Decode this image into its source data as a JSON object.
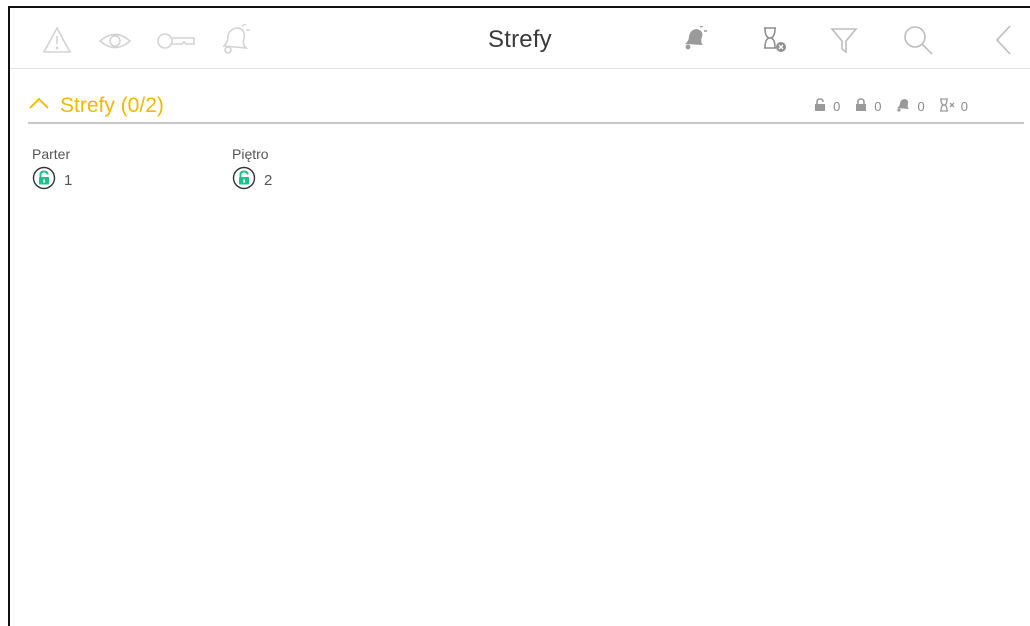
{
  "header": {
    "title": "Strefy",
    "icons_left": [
      "warning-icon",
      "eye-icon",
      "key-icon",
      "bell-outline-icon"
    ],
    "icons_right": [
      "alarm-bell-icon",
      "hourglass-x-icon",
      "filter-icon",
      "search-icon",
      "back-icon"
    ]
  },
  "section": {
    "title": "Strefy (0/2)",
    "counts": [
      {
        "icon": "unlocked-icon",
        "value": "0"
      },
      {
        "icon": "locked-icon",
        "value": "0"
      },
      {
        "icon": "alarm-icon",
        "value": "0"
      },
      {
        "icon": "hourglass-icon",
        "value": "0"
      }
    ]
  },
  "zones": [
    {
      "name": "Parter",
      "number": "1",
      "state": "unlocked"
    },
    {
      "name": "Piętro",
      "number": "2",
      "state": "unlocked"
    }
  ],
  "colors": {
    "accent": "#f2b705",
    "zone_green": "#1fc28c",
    "icon_gray": "#cfcfcf"
  }
}
